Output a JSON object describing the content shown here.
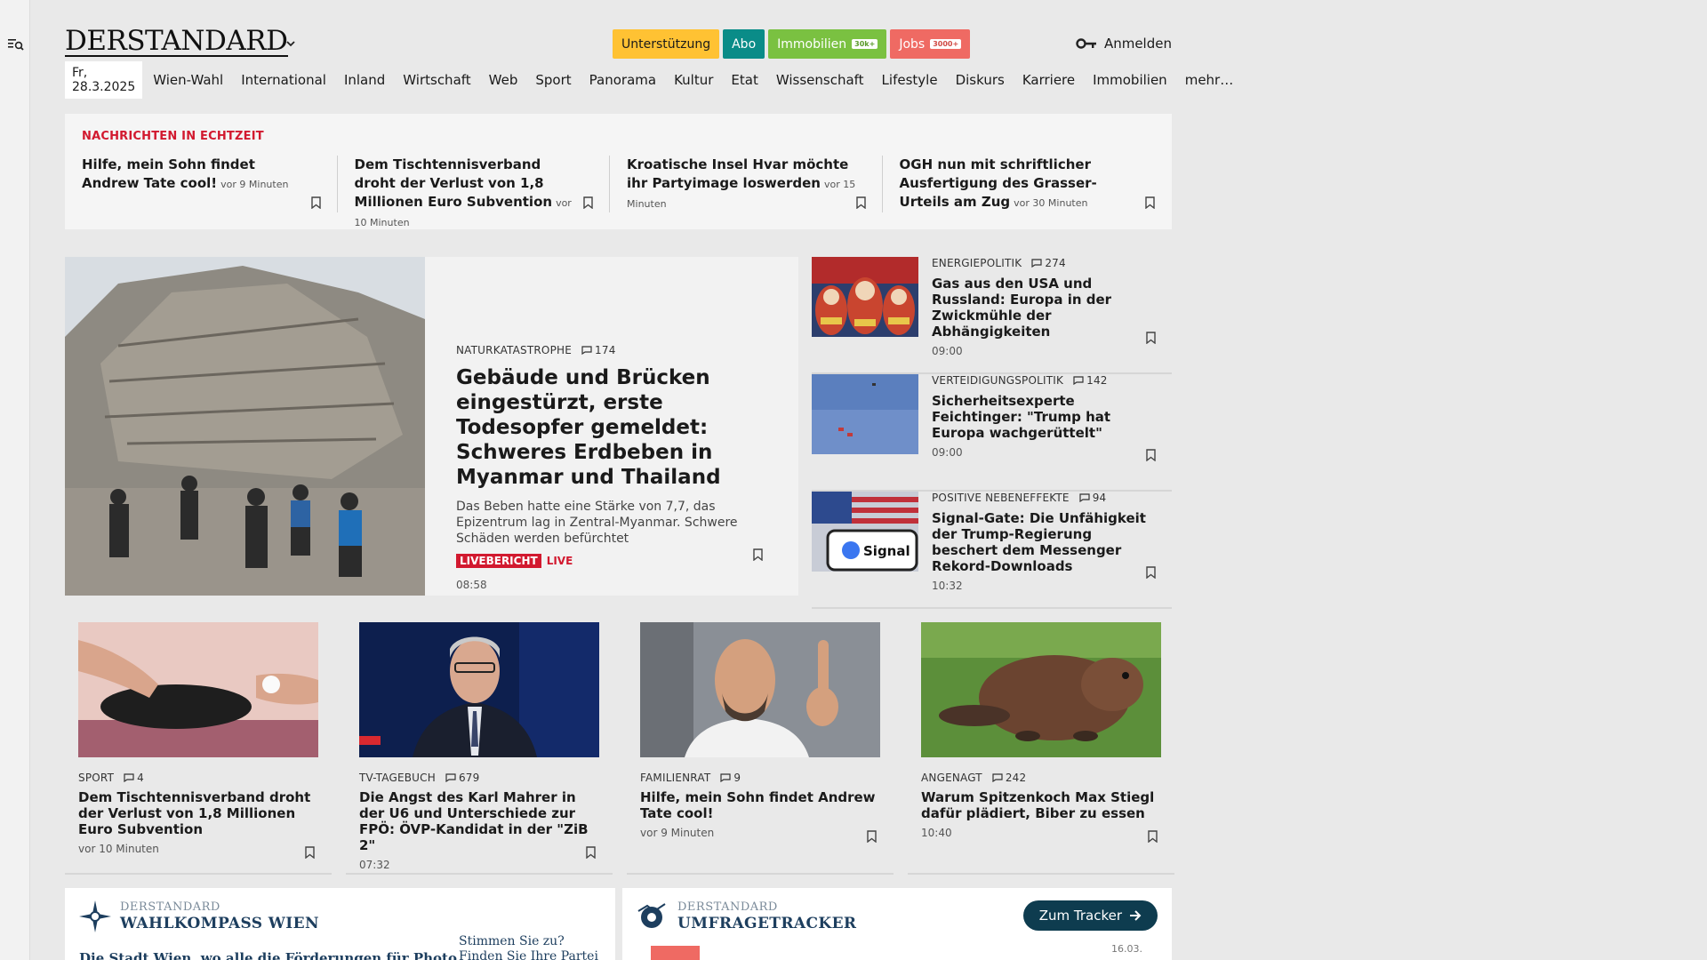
{
  "header": {
    "logo": "DERSTANDARD",
    "pills": [
      {
        "label": "Unterstützung",
        "tag": ""
      },
      {
        "label": "Abo",
        "tag": ""
      },
      {
        "label": "Immobilien",
        "tag": "30k+"
      },
      {
        "label": "Jobs",
        "tag": "3000+"
      }
    ],
    "login": "Anmelden"
  },
  "nav": {
    "date": "Fr, 28.3.2025",
    "items": [
      "Wien-Wahl",
      "International",
      "Inland",
      "Wirtschaft",
      "Web",
      "Sport",
      "Panorama",
      "Kultur",
      "Etat",
      "Wissenschaft",
      "Lifestyle",
      "Diskurs",
      "Karriere",
      "Immobilien",
      "mehr…"
    ]
  },
  "ticker": {
    "kicker": "NACHRICHTEN IN ECHTZEIT",
    "items": [
      {
        "title": "Hilfe, mein Sohn findet Andrew Tate cool!",
        "ago": "vor 9 Minuten"
      },
      {
        "title": "Dem Tischtennisverband droht der Verlust von 1,8 Millionen Euro Subvention",
        "ago": "vor 10 Minuten"
      },
      {
        "title": "Kroatische Insel Hvar möchte ihr Partyimage loswerden",
        "ago": "vor 15 Minuten"
      },
      {
        "title": "OGH nun mit schriftlicher Ausfertigung des Grasser-Urteils am Zug",
        "ago": "vor 30 Minuten"
      }
    ]
  },
  "lead": {
    "kicker": "NATURKATASTROPHE",
    "comments": "174",
    "title": "Gebäude und Brücken eingestürzt, erste Todesopfer gemeldet: Schweres Erdbeben in Myanmar und Thailand",
    "teaser": "Das Beben hatte eine Stärke von 7,7, das Epizentrum lag in Zentral-Myanmar. Schwere Schäden werden befürchtet",
    "badge": "LIVEBERICHT",
    "live": "LIVE",
    "time": "08:58"
  },
  "side": [
    {
      "kicker": "ENERGIEPOLITIK",
      "comments": "274",
      "title": "Gas aus den USA und Russland: Europa in der Zwickmühle der Abhängigkeiten",
      "time": "09:00"
    },
    {
      "kicker": "VERTEIDIGUNGSPOLITIK",
      "comments": "142",
      "title": "Sicherheitsexperte Feichtinger: \"Trump hat Europa wachgerüttelt\"",
      "time": "09:00"
    },
    {
      "kicker": "POSITIVE NEBENEFFEKTE",
      "comments": "94",
      "title": "Signal-Gate: Die Unfähigkeit der Trump-Regierung beschert dem Messenger Rekord-Downloads",
      "time": "10:32",
      "thumb_text": "Signal"
    }
  ],
  "cards": [
    {
      "kicker": "SPORT",
      "comments": "4",
      "title": "Dem Tischtennisverband droht der Verlust von 1,8 Millionen Euro Subvention",
      "time": "vor 10 Minuten"
    },
    {
      "kicker": "TV-TAGEBUCH",
      "comments": "679",
      "title": "Die Angst des Karl Mahrer in der U6 und Unterschiede zur FPÖ: ÖVP-Kandidat in der \"ZiB 2\"",
      "time": "07:32"
    },
    {
      "kicker": "FAMILIENRAT",
      "comments": "9",
      "title": "Hilfe, mein Sohn findet Andrew Tate cool!",
      "time": "vor 9 Minuten"
    },
    {
      "kicker": "ANGENAGT",
      "comments": "242",
      "title": "Warum Spitzenkoch Max Stiegl dafür plädiert, Biber zu essen",
      "time": "10:40"
    }
  ],
  "widgets": {
    "wahl": {
      "brand": "DERSTANDARD",
      "title": "WAHLKOMPASS WIEN",
      "text_left": "Die Stadt Wien, wo alle die Förderungen für Photo",
      "text_right": "Stimmen Sie zu? Finden Sie Ihre Partei"
    },
    "tracker": {
      "brand": "DERSTANDARD",
      "title": "UMFRAGETRACKER",
      "button": "Zum Tracker",
      "date": "16.03."
    }
  },
  "colors": {
    "accent_red": "#d2192f",
    "navy": "#0e3c4f"
  }
}
